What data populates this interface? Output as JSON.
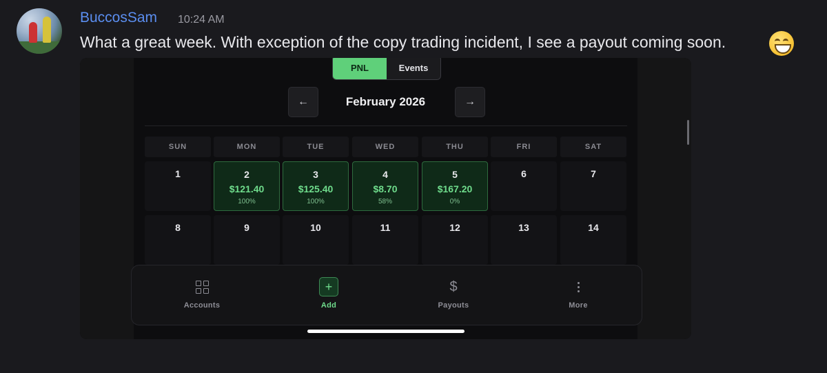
{
  "message": {
    "username": "BuccosSam",
    "timestamp": "10:24 AM",
    "text": "What a great week. With exception of the copy trading incident, I see a payout coming soon.",
    "emoji": "grinning-face-emoji"
  },
  "app": {
    "toggle": {
      "pnl_label": "PNL",
      "events_label": "Events",
      "active": "PNL"
    },
    "calendar": {
      "month_label": "February 2026",
      "prev_icon": "arrow-left-icon",
      "next_icon": "arrow-right-icon",
      "weekdays": [
        "SUN",
        "MON",
        "TUE",
        "WED",
        "THU",
        "FRI",
        "SAT"
      ],
      "week1": [
        {
          "day": "1"
        },
        {
          "day": "2",
          "pnl": "$121.40",
          "pct": "100%"
        },
        {
          "day": "3",
          "pnl": "$125.40",
          "pct": "100%"
        },
        {
          "day": "4",
          "pnl": "$8.70",
          "pct": "58%"
        },
        {
          "day": "5",
          "pnl": "$167.20",
          "pct": "0%"
        },
        {
          "day": "6"
        },
        {
          "day": "7"
        }
      ],
      "week2": [
        {
          "day": "8"
        },
        {
          "day": "9"
        },
        {
          "day": "10"
        },
        {
          "day": "11"
        },
        {
          "day": "12"
        },
        {
          "day": "13"
        },
        {
          "day": "14"
        }
      ]
    },
    "bottom_nav": {
      "accounts": "Accounts",
      "add": "Add",
      "payouts": "Payouts",
      "more": "More"
    },
    "colors": {
      "accent": "#5fd07a",
      "profit_text": "#6fdc8c",
      "username": "#5b8ef0"
    }
  }
}
